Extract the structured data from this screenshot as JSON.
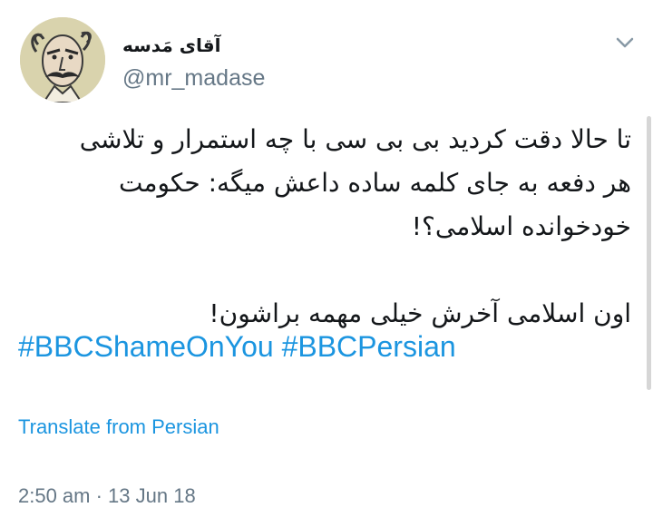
{
  "author": {
    "display_name": "آقای مَدسه",
    "handle": "@mr_madase",
    "avatar_icon": "cartoon-portrait"
  },
  "tweet": {
    "lines": [
      "تا حالا دقت کردید بی بی سی با چه استمرار و تلاشی",
      "هر دفعه به جای کلمه ساده داعش میگه: حکومت",
      "خودخوانده اسلامی؟!",
      "اون اسلامی آخرش خیلی مهمه براشون!"
    ],
    "hashtags": [
      "#BBCShameOnYou",
      "#BBCPersian"
    ],
    "translate_label": "Translate from Persian",
    "timestamp": "2:50 am · 13 Jun 18"
  },
  "colors": {
    "link": "#1b95e0",
    "secondary": "#657786",
    "text": "#14171a"
  },
  "icons": {
    "menu": "chevron-down-icon"
  }
}
